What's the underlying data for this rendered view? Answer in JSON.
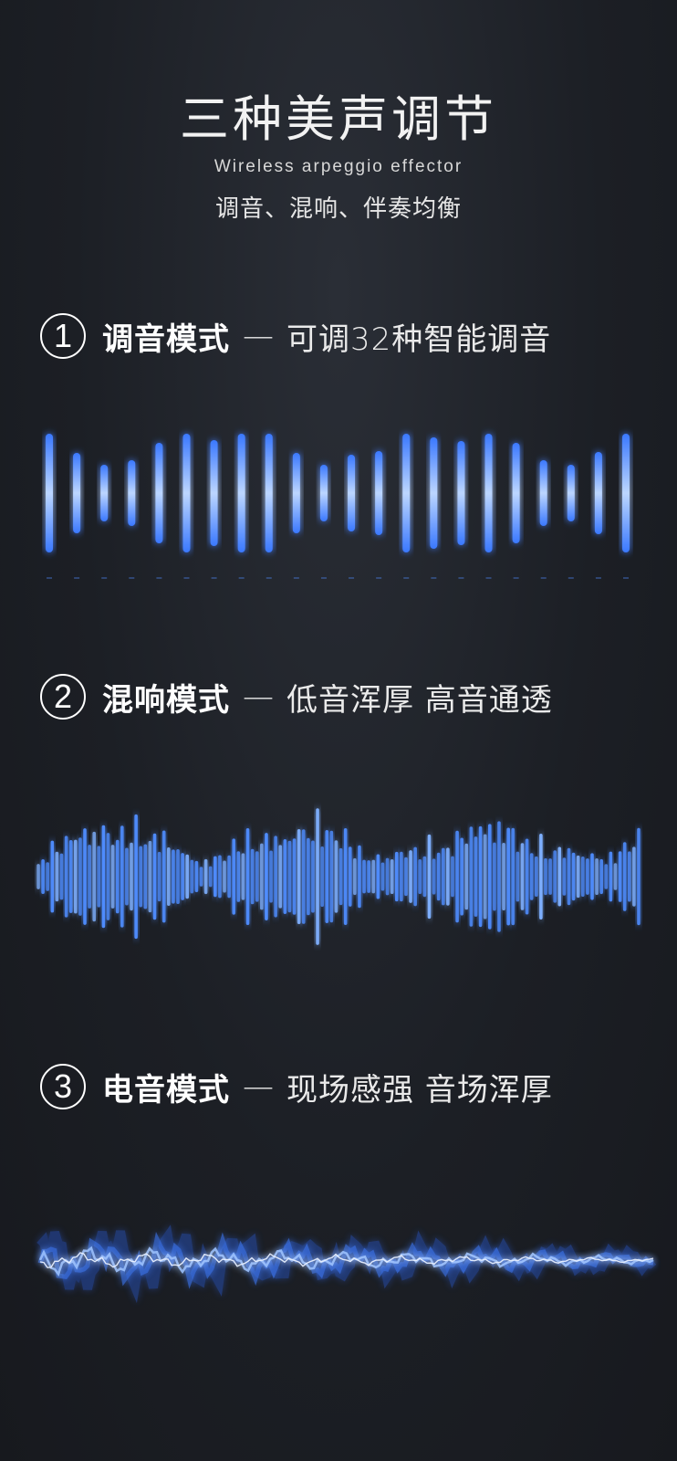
{
  "header": {
    "title": "三种美声调节",
    "subtitle_en": "Wireless arpeggio effector",
    "subtitle_cn": "调音、混响、伴奏均衡"
  },
  "modes": [
    {
      "number": "1",
      "name": "调音模式",
      "dash": "—",
      "desc": "可调32种智能调音"
    },
    {
      "number": "2",
      "name": "混响模式",
      "dash": "—",
      "desc": "低音浑厚 高音通透"
    },
    {
      "number": "3",
      "name": "电音模式",
      "dash": "—",
      "desc": "现场感强 音场浑厚"
    }
  ],
  "colors": {
    "accent_blue": "#4f8dff",
    "glow_blue": "#2f6bff",
    "background": "#1c1f25"
  },
  "visuals": {
    "mode1": "bar-equalizer",
    "mode2": "waveform-bars",
    "mode3": "electric-wave"
  }
}
